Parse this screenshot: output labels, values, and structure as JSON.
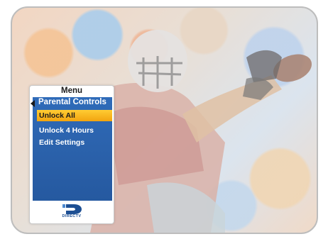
{
  "menu": {
    "title": "Menu",
    "header": "Parental Controls",
    "items": [
      {
        "label": "Unlock All",
        "selected": true
      },
      {
        "label": "Unlock 4 Hours",
        "selected": false
      },
      {
        "label": "Edit Settings",
        "selected": false
      }
    ]
  },
  "logo": {
    "text": "DIRECTV"
  },
  "colors": {
    "menu_blue": "#2a60a9",
    "highlight_yellow": "#f2b21a",
    "logo_blue": "#1d4f93"
  },
  "icons": {
    "back": "left-arrow-icon",
    "brand": "directv-logo-icon"
  }
}
